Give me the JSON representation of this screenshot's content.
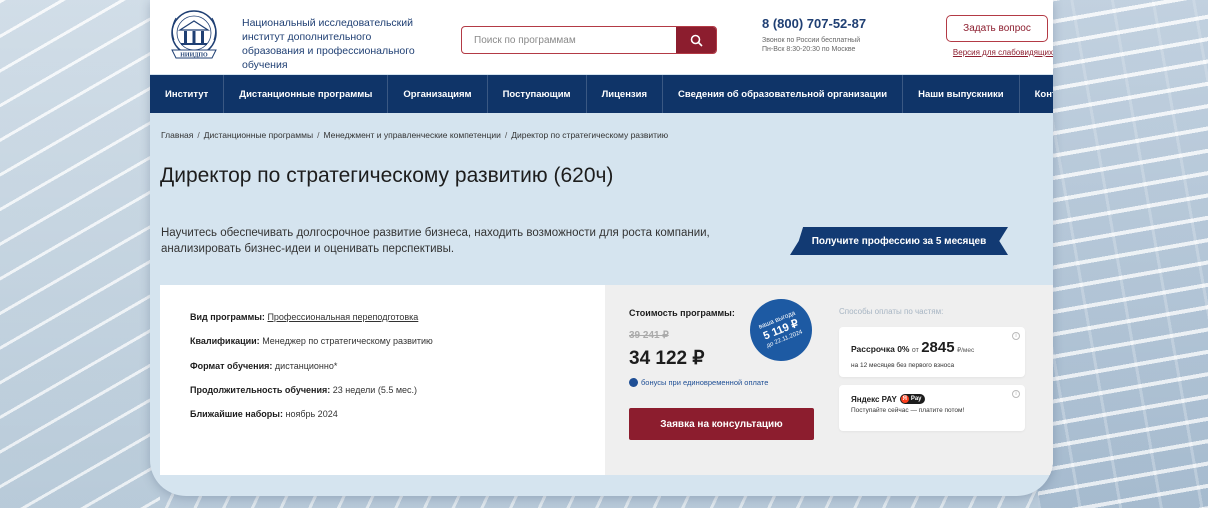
{
  "header": {
    "institute_name": "Национальный исследовательский институт дополнительного образования и профессионального обучения",
    "logo_text": "НИИДПО",
    "search_placeholder": "Поиск по программам",
    "phone": "8 (800) 707-52-87",
    "phone_note_1": "Звонок по России бесплатный",
    "phone_note_2": "Пн-Вск 8:30-20:30 по Москве",
    "ask_button": "Задать вопрос",
    "low_vision_link": "Версия для слабовидящих"
  },
  "nav": {
    "items": [
      "Институт",
      "Дистанционные программы",
      "Организациям",
      "Поступающим",
      "Лицензия",
      "Сведения об образовательной организации",
      "Наши выпускники",
      "Контакты"
    ]
  },
  "breadcrumb": {
    "items": [
      "Главная",
      "Дистанционные программы",
      "Менеджмент и управленческие компетенции",
      "Директор по стратегическому развитию"
    ]
  },
  "page": {
    "title": "Директор по стратегическому развитию (620ч)",
    "lead": "Научитесь обеспечивать долгосрочное развитие бизнеса, находить возможности для роста компании, анализировать бизнес-идеи и оценивать перспективы.",
    "promo": "Получите профессию за 5 месяцев"
  },
  "program": {
    "type_label": "Вид программы:",
    "type_value": "Профессиональная переподготовка",
    "qualification_label": "Квалификации:",
    "qualification_value": "Менеджер по стратегическому развитию",
    "format_label": "Формат обучения:",
    "format_value": "дистанционно*",
    "duration_label": "Продолжительность обучения:",
    "duration_value": "23 недели (5.5 мес.)",
    "intake_label": "Ближайшие наборы:",
    "intake_value": "ноябрь 2024"
  },
  "pricing": {
    "cost_label": "Стоимость программы:",
    "old_price": "39 241 ₽",
    "price": "34 122 ₽",
    "badge_line1": "ваша выгода",
    "badge_amount": "5 119 ₽",
    "badge_line3": "до 22.11.2024",
    "bonus_text": "бонусы при единовременной оплате",
    "consult_button": "Заявка на консультацию"
  },
  "installments": {
    "label": "Способы оплаты по частям:",
    "plan1_title": "Рассрочка 0%",
    "plan1_from": "от",
    "plan1_amount": "2845",
    "plan1_unit": "₽/мес",
    "plan1_sub": "на 12 месяцев без первого взноса",
    "plan2_title": "Яндекс PAY",
    "plan2_logo": "Pay",
    "plan2_sub": "Поступайте сейчас — платите потом!"
  },
  "colors": {
    "navy": "#0f3468",
    "maroon": "#8c1d2e",
    "badge_blue": "#1d5aa3"
  }
}
